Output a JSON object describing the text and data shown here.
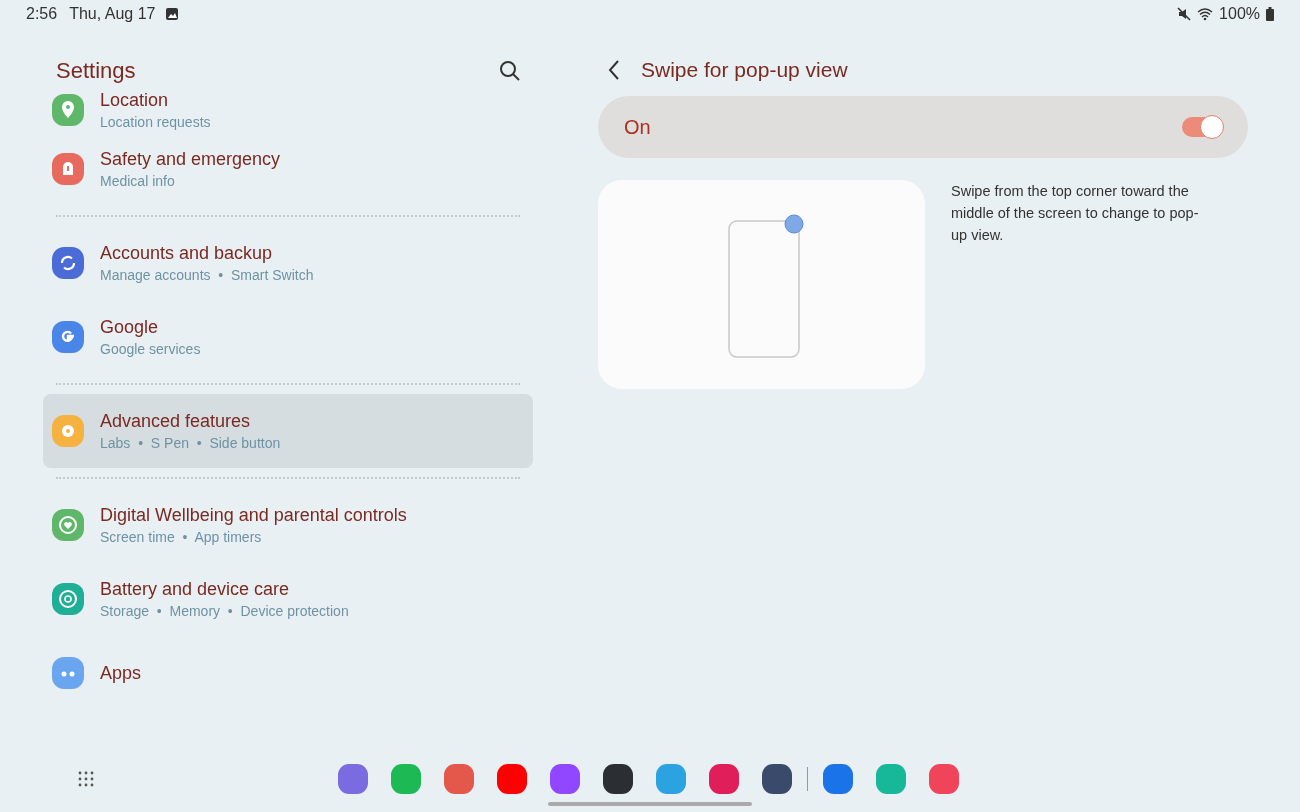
{
  "status_bar": {
    "time": "2:56",
    "date": "Thu, Aug 17",
    "battery": "100%"
  },
  "sidebar": {
    "title": "Settings",
    "groups": [
      [
        {
          "title": "Location",
          "subtitle": "Location requests",
          "kind": "pin",
          "color": "#5fb86a",
          "selected": false
        },
        {
          "title": "Safety and emergency",
          "subtitle": "Medical info",
          "kind": "alert",
          "color": "#e8695d",
          "selected": false
        }
      ],
      [
        {
          "title": "Accounts and backup",
          "subtitle": "Manage accounts  •  Smart Switch",
          "kind": "sync",
          "color": "#4b6bd6",
          "selected": false
        },
        {
          "title": "Google",
          "subtitle": "Google services",
          "kind": "letter",
          "color": "#4a86e8",
          "selected": false
        }
      ],
      [
        {
          "title": "Advanced features",
          "subtitle": "Labs  •  S Pen  •  Side button",
          "kind": "gear",
          "color": "#f5b240",
          "selected": true
        }
      ],
      [
        {
          "title": "Digital Wellbeing and parental controls",
          "subtitle": "Screen time  •  App timers",
          "kind": "heart",
          "color": "#5fb86a",
          "selected": false
        },
        {
          "title": "Battery and device care",
          "subtitle": "Storage  •  Memory  •  Device protection",
          "kind": "ring",
          "color": "#1fae96",
          "selected": false
        },
        {
          "title": "Apps",
          "kind": "dots",
          "color": "#6aa6f0",
          "selected": false
        }
      ]
    ]
  },
  "detail": {
    "title": "Swipe for pop-up view",
    "switch": {
      "label": "On",
      "on": true
    },
    "description": "Swipe from the top corner toward the middle of the screen to change to pop-up view."
  },
  "dock": [
    {
      "color": "#7a6be0"
    },
    {
      "color": "#1db954"
    },
    {
      "color": "#e4574b"
    },
    {
      "color": "#ff0000"
    },
    {
      "color": "#9146ff"
    },
    {
      "color": "#2b2f33"
    },
    {
      "color": "#2aa3e0"
    },
    {
      "color": "#e01e5a"
    },
    {
      "color": "#3a4a6b"
    },
    {
      "color": "#1a73e8"
    },
    {
      "color": "#17b89a"
    },
    {
      "color": "#f0445a"
    }
  ]
}
